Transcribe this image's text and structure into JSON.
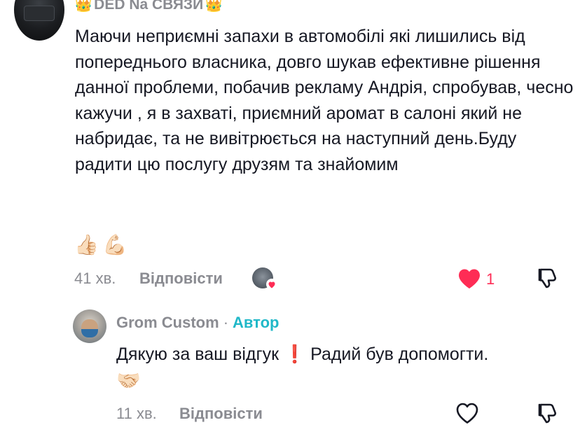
{
  "main_comment": {
    "username": "DED Na СВЯЗИ",
    "crown_left": "👑",
    "crown_right": "👑",
    "text": "Маючи неприємні запахи в автомобілі які лишились від попереднього власника, довго шукав ефективне рішення данної проблеми, побачив рекламу Андрія, спробував, чесно кажучи , я в захваті, приємний аромат в салоні який не набридає, та не вивітрюється на наступний день.Буду радити цю послугу друзям та знайомим",
    "emojis": "👍🏻💪🏻",
    "time": "41 хв.",
    "reply_label": "Відповісти",
    "like_count": "1",
    "liked": true
  },
  "reply_comment": {
    "username": "Grom Custom",
    "separator": "·",
    "author_badge": "Автор",
    "text": "Дякую за ваш відгук ❗ Радий був допомогти.",
    "emoji": "🤝🏻",
    "time": "11 хв.",
    "reply_label": "Відповісти",
    "liked": false
  },
  "colors": {
    "text": "#161823",
    "muted": "#8a8b91",
    "like_red": "#fe2c55",
    "author_teal": "#20b8c8"
  },
  "icons": [
    "heart-icon",
    "dislike-icon",
    "crown-icon"
  ]
}
